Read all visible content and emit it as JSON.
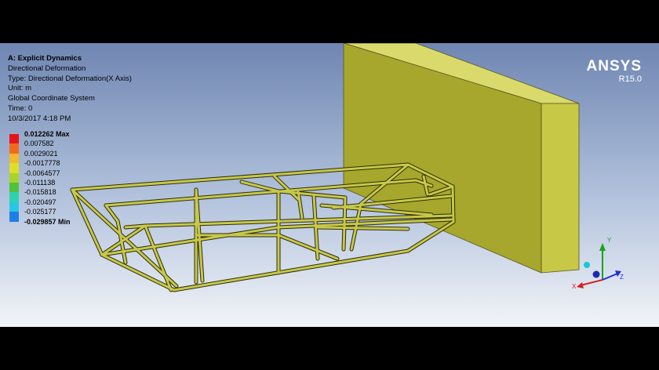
{
  "header": {
    "analysis_title": "A: Explicit Dynamics",
    "result_name": "Directional Deformation",
    "type_line": "Type: Directional Deformation(X Axis)",
    "unit_line": "Unit: m",
    "coord_line": "Global Coordinate System",
    "time_line": "Time: 0",
    "date_line": "10/3/2017 4:18 PM"
  },
  "legend": {
    "max_label": "0.012262 Max",
    "min_label": "-0.029857 Min",
    "values": [
      "0.012262 Max",
      "0.007582",
      "0.0029021",
      "-0.0017778",
      "-0.0064577",
      "-0.011138",
      "-0.015818",
      "-0.020497",
      "-0.025177",
      "-0.029857 Min"
    ],
    "colors": [
      "#e8141c",
      "#f06a1e",
      "#f2b92a",
      "#dede27",
      "#a8d42a",
      "#4fc33a",
      "#2ed2ae",
      "#27c7e6",
      "#1e7fe3",
      "#1a28d8"
    ]
  },
  "brand": {
    "name": "ANSYS",
    "version": "R15.0"
  },
  "triad": {
    "x_label": "X",
    "y_label": "Y",
    "z_label": "Z"
  },
  "colors": {
    "frame": "#c8c84a",
    "frame_outline": "#2d2d08",
    "wall_front": "#c7c846",
    "wall_side": "#a6a72c",
    "wall_top": "#dada6c"
  }
}
